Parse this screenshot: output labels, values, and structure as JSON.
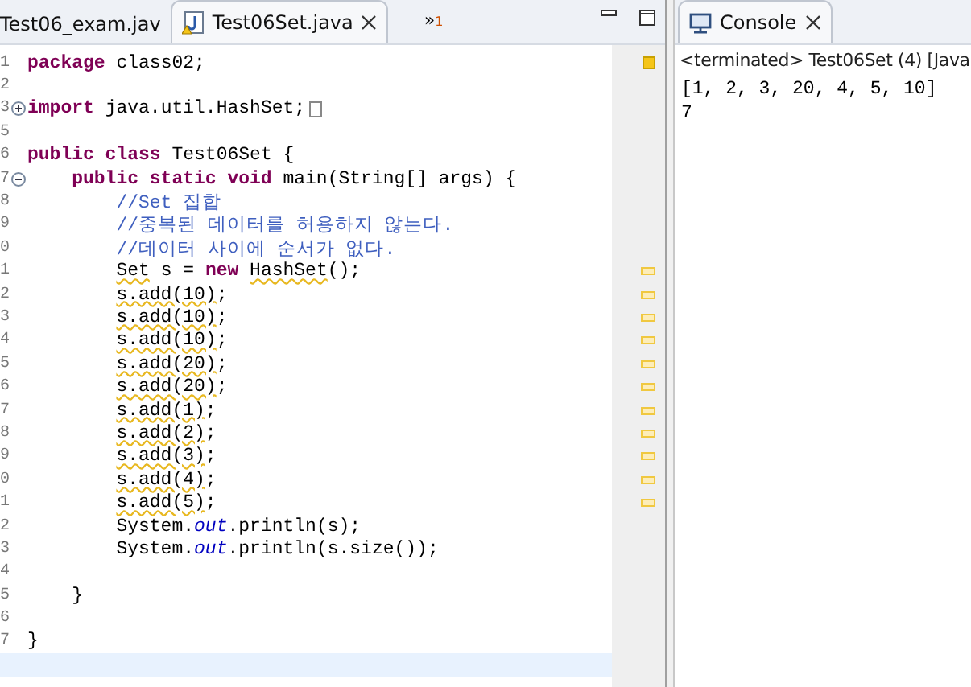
{
  "editor": {
    "tabs": [
      {
        "label": "Test06_exam.jav",
        "selected": false,
        "closable": false
      },
      {
        "label": "Test06Set.java",
        "selected": true,
        "closable": true
      }
    ],
    "overflow": {
      "chevron": "»",
      "count": "1"
    },
    "lines": [
      {
        "num": "1",
        "segs": [
          {
            "t": "package",
            "kind": "kw"
          },
          {
            "t": " class02;"
          }
        ]
      },
      {
        "num": "2"
      },
      {
        "num": "3",
        "collapsed": true,
        "segs": [
          {
            "t": "import",
            "kind": "kw"
          },
          {
            "t": " java.util.HashSet;"
          }
        ]
      },
      {
        "num": "5"
      },
      {
        "num": "6",
        "segs": [
          {
            "t": "public class",
            "kind": "kw"
          },
          {
            "t": " Test06Set {"
          }
        ],
        "children": [
          {
            "num": "7",
            "collapsed": false,
            "segs": [
              {
                "t": "public static void",
                "kind": "kw"
              },
              {
                "t": " main(String[] args) {"
              }
            ],
            "children": [
              {
                "num": "8",
                "segs": [
                  {
                    "t": "//Set 집합",
                    "kind": "comment"
                  }
                ]
              },
              {
                "num": "9",
                "segs": [
                  {
                    "t": "//중복된 데이터를 허용하지 않는다.",
                    "kind": "comment"
                  }
                ]
              },
              {
                "num": "0",
                "segs": [
                  {
                    "t": "//데이터 사이에 순서가 없다.",
                    "kind": "comment"
                  }
                ]
              },
              {
                "num": "1",
                "marker": true,
                "segs": [
                  {
                    "t": "Set",
                    "warn": true
                  },
                  {
                    "t": " s = "
                  },
                  {
                    "t": "new ",
                    "kind": "kw"
                  },
                  {
                    "t": "HashSet",
                    "warn": true
                  },
                  {
                    "t": "();"
                  }
                ]
              },
              {
                "num": "2",
                "marker": true,
                "segs": [
                  {
                    "t": "s.add(10)",
                    "warn": true
                  },
                  {
                    "t": ";"
                  }
                ]
              },
              {
                "num": "3",
                "marker": true,
                "segs": [
                  {
                    "t": "s.add(10)",
                    "warn": true
                  },
                  {
                    "t": ";"
                  }
                ]
              },
              {
                "num": "4",
                "marker": true,
                "segs": [
                  {
                    "t": "s.add(10)",
                    "warn": true
                  },
                  {
                    "t": ";"
                  }
                ]
              },
              {
                "num": "5",
                "marker": true,
                "segs": [
                  {
                    "t": "s.add(20)",
                    "warn": true
                  },
                  {
                    "t": ";"
                  }
                ]
              },
              {
                "num": "6",
                "marker": true,
                "segs": [
                  {
                    "t": "s.add(20)",
                    "warn": true
                  },
                  {
                    "t": ";"
                  }
                ]
              },
              {
                "num": "7",
                "marker": true,
                "segs": [
                  {
                    "t": "s.add(1)",
                    "warn": true
                  },
                  {
                    "t": ";"
                  }
                ]
              },
              {
                "num": "8",
                "marker": true,
                "segs": [
                  {
                    "t": "s.add(2)",
                    "warn": true
                  },
                  {
                    "t": ";"
                  }
                ]
              },
              {
                "num": "9",
                "marker": true,
                "segs": [
                  {
                    "t": "s.add(3)",
                    "warn": true
                  },
                  {
                    "t": ";"
                  }
                ]
              },
              {
                "num": "0",
                "marker": true,
                "segs": [
                  {
                    "t": "s.add(4)",
                    "warn": true
                  },
                  {
                    "t": ";"
                  }
                ]
              },
              {
                "num": "1",
                "marker": true,
                "segs": [
                  {
                    "t": "s.add(5)",
                    "warn": true
                  },
                  {
                    "t": ";"
                  }
                ]
              },
              {
                "num": "2",
                "segs": [
                  {
                    "t": "System."
                  },
                  {
                    "t": "out",
                    "kind": "field"
                  },
                  {
                    "t": ".println(s);"
                  }
                ]
              },
              {
                "num": "3",
                "segs": [
                  {
                    "t": "System."
                  },
                  {
                    "t": "out",
                    "kind": "field"
                  },
                  {
                    "t": ".println(s.size());"
                  }
                ]
              },
              {
                "num": "4"
              }
            ]
          },
          {
            "num": "5",
            "segs": [
              {
                "t": "}"
              }
            ]
          },
          {
            "num": "6"
          }
        ]
      },
      {
        "num": "7",
        "segs": [
          {
            "t": "}"
          }
        ]
      },
      {
        "current": true
      }
    ]
  },
  "console": {
    "tab": {
      "label": "Console",
      "selected": true
    },
    "status": "<terminated> Test06Set (4) [Java",
    "output": [
      "[1, 2, 3, 20, 4, 5, 10]",
      "7"
    ]
  }
}
